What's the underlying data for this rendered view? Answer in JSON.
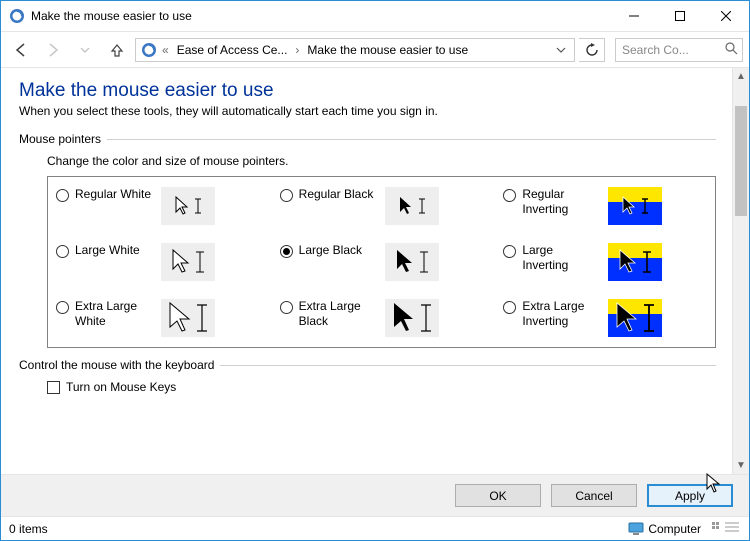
{
  "window": {
    "title": "Make the mouse easier to use"
  },
  "breadcrumb": {
    "crumb1": "Ease of Access Ce...",
    "crumb2": "Make the mouse easier to use"
  },
  "search": {
    "placeholder": "Search Co..."
  },
  "page": {
    "heading": "Make the mouse easier to use",
    "subtitle": "When you select these tools, they will automatically start each time you sign in."
  },
  "group_pointers": {
    "title": "Mouse pointers",
    "desc": "Change the color and size of mouse pointers.",
    "options": {
      "o0": "Regular White",
      "o1": "Regular Black",
      "o2": "Regular Inverting",
      "o3": "Large White",
      "o4": "Large Black",
      "o5": "Large Inverting",
      "o6": "Extra Large White",
      "o7": "Extra Large Black",
      "o8": "Extra Large Inverting"
    },
    "selected": "o4"
  },
  "group_keyboard": {
    "title": "Control the mouse with the keyboard",
    "check1": "Turn on Mouse Keys"
  },
  "buttons": {
    "ok": "OK",
    "cancel": "Cancel",
    "apply": "Apply"
  },
  "status": {
    "items": "0 items",
    "computer": "Computer"
  }
}
